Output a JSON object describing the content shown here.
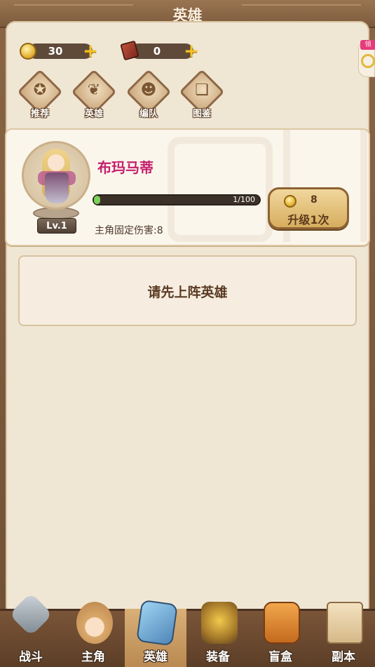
{
  "header": {
    "title": "英雄"
  },
  "currencies": [
    {
      "icon": "coin-icon",
      "value": "30"
    },
    {
      "icon": "book-icon",
      "value": "0"
    }
  ],
  "side_tab": {
    "badge": "领"
  },
  "nav": [
    {
      "label": "推荐",
      "icon": "recommend-icon",
      "glyph": "✪"
    },
    {
      "label": "英雄",
      "icon": "hero-icon",
      "glyph": "❦"
    },
    {
      "label": "编队",
      "icon": "formation-icon",
      "glyph": "☻"
    },
    {
      "label": "图鉴",
      "icon": "codex-icon",
      "glyph": "❏"
    }
  ],
  "hero": {
    "name": "布玛马蒂",
    "level": "Lv.1",
    "xp_text": "1/100",
    "xp_fraction": 0.01,
    "damage_text": "主角固定伤害:8",
    "upgrade_cost": "8",
    "upgrade_label": "升级1次"
  },
  "notice": {
    "text": "请先上阵英雄"
  },
  "bottom_tabs": [
    {
      "label": "战斗",
      "icon": "crossed-swords-icon",
      "active": false
    },
    {
      "label": "主角",
      "icon": "protagonist-icon",
      "active": false
    },
    {
      "label": "英雄",
      "icon": "hero-cards-icon",
      "active": true
    },
    {
      "label": "装备",
      "icon": "equipment-icon",
      "active": false
    },
    {
      "label": "盲盒",
      "icon": "gift-box-icon",
      "active": false
    },
    {
      "label": "副本",
      "icon": "scroll-map-icon",
      "active": false
    }
  ]
}
